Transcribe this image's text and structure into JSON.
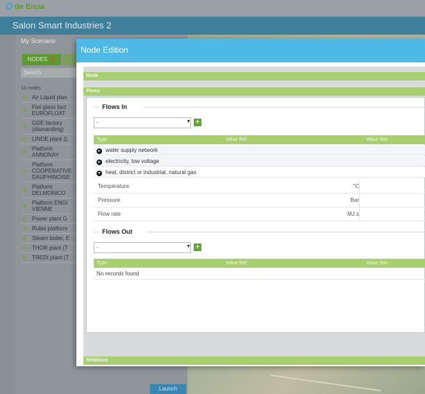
{
  "app": {
    "logo_text": "de Ercia",
    "title": "Salon Smart Industries 2"
  },
  "sidebar": {
    "scenario_label": "My Scenario",
    "nodes_tab": "NODES ❓",
    "search_placeholder": "Search",
    "count_text": "13 nodes",
    "nodes": [
      "Air Liquid plan",
      "Flat glass fact\nEUROFLOAT",
      "GDE factory\n(dismantling)",
      "LINDE plant (L",
      "Platform\nANNONAY",
      "Platform\nCOOPERATIVE\nDAUPHINOISE",
      "Platform\nDELMONICO",
      "Platform ENGI\nVIENNE",
      "Power plant G",
      "Rubis platform",
      "Steam boiler, E",
      "THOR plant (T",
      "TREDI plant (T"
    ],
    "launch_label": "Launch"
  },
  "modal": {
    "title": "Node Edition",
    "node_panel": "Node",
    "flows_panel": "Flows",
    "relations_panel": "Relations",
    "flows_in": {
      "heading": "Flows In",
      "select_value": "-",
      "columns": [
        "Type",
        "Value Ref",
        "Value Sim"
      ],
      "options": [
        "water supply network",
        "electricity, low voltage",
        "heat, district or industrial, natural gas"
      ],
      "params": [
        {
          "name": "Temperature",
          "unit": "°C"
        },
        {
          "name": "Pressure",
          "unit": "Bar"
        },
        {
          "name": "Flow rate",
          "unit": "MJ.s"
        }
      ]
    },
    "flows_out": {
      "heading": "Flows Out",
      "select_value": "-",
      "columns": [
        "Type",
        "Value Ref",
        "Value Sim"
      ],
      "empty_text": "No records found"
    }
  },
  "colors": {
    "accent_blue": "#4fb9e6",
    "accent_green": "#a7cf6e",
    "add_green": "#58a832"
  }
}
